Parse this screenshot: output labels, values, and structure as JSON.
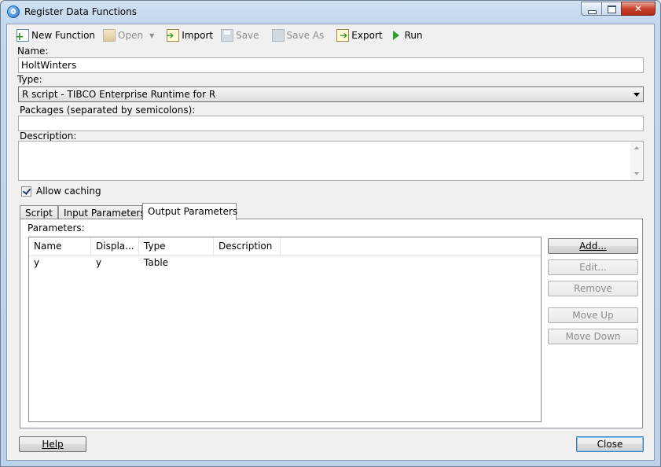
{
  "window": {
    "title": "Register Data Functions"
  },
  "toolbar": {
    "new_function": "New Function",
    "open": "Open",
    "import": "Import",
    "save": "Save",
    "save_as": "Save As",
    "export": "Export",
    "run": "Run"
  },
  "form": {
    "name_label": "Name:",
    "name_value": "HoltWinters",
    "type_label": "Type:",
    "type_value": "R script - TIBCO Enterprise Runtime for R",
    "packages_label": "Packages (separated by semicolons):",
    "packages_value": "",
    "description_label": "Description:",
    "description_value": "",
    "allow_caching_label": "Allow caching",
    "allow_caching_checked": true
  },
  "tabs": [
    {
      "label": "Script",
      "active": false
    },
    {
      "label": "Input Parameters",
      "active": false
    },
    {
      "label": "Output Parameters",
      "active": true
    }
  ],
  "parameters": {
    "label": "Parameters:",
    "columns": [
      "Name",
      "Displa...",
      "Type",
      "Description"
    ],
    "rows": [
      {
        "name": "y",
        "display": "y",
        "type": "Table",
        "description": ""
      }
    ]
  },
  "side_buttons": {
    "add": "Add...",
    "edit": "Edit...",
    "remove": "Remove",
    "move_up": "Move Up",
    "move_down": "Move Down"
  },
  "footer": {
    "help": "Help",
    "close": "Close"
  }
}
